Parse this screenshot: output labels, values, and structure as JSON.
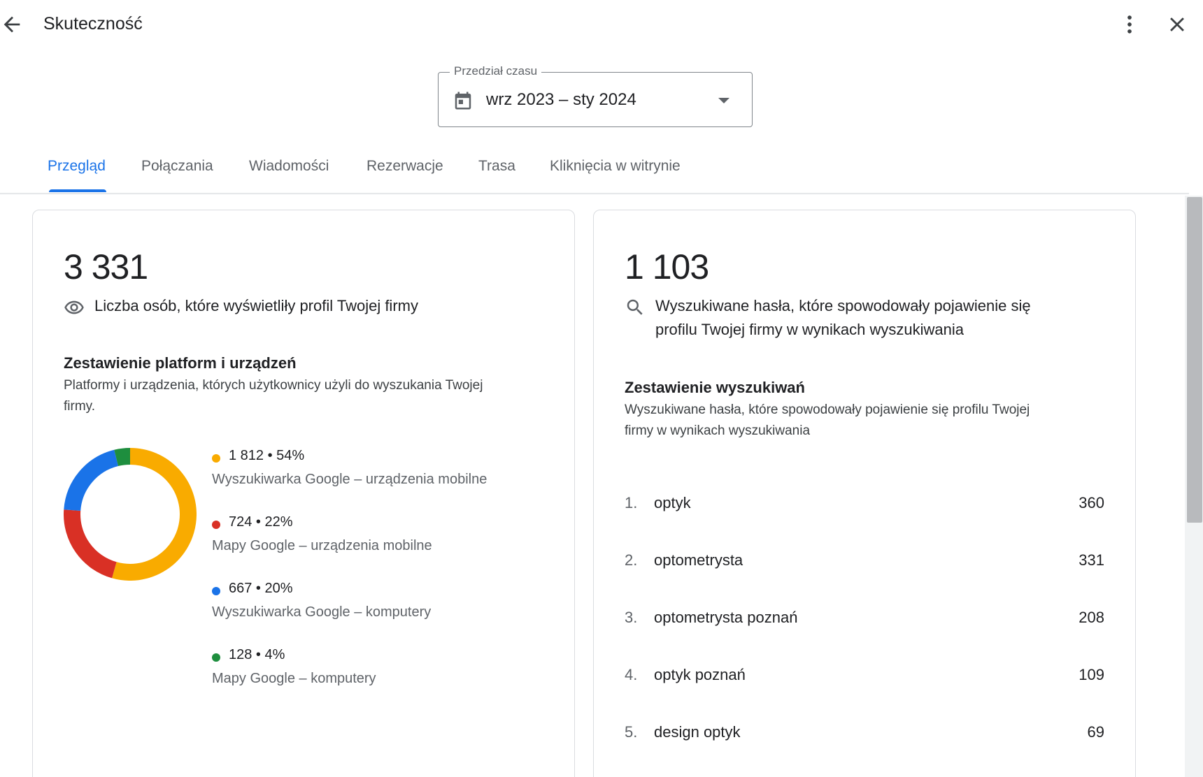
{
  "header": {
    "title": "Skuteczność",
    "icons": {
      "back": "arrow-back-icon",
      "more": "more-vert-icon",
      "close": "close-icon"
    }
  },
  "range": {
    "label": "Przedział czasu",
    "value": "wrz 2023 – sty 2024",
    "icon": "calendar-icon"
  },
  "tabs": [
    {
      "label": "Przegląd",
      "active": true
    },
    {
      "label": "Połączania",
      "active": false
    },
    {
      "label": "Wiadomości",
      "active": false
    },
    {
      "label": "Rezerwacje",
      "active": false
    },
    {
      "label": "Trasa",
      "active": false
    },
    {
      "label": "Kliknięcia w witrynie",
      "active": false
    }
  ],
  "views_card": {
    "total": "3 331",
    "metric_label": "Liczba osób, które wyświetliły profil Twojej firmy",
    "metric_icon": "eye-icon",
    "section_title": "Zestawienie platform i urządzeń",
    "section_desc_line1": "Platformy i urządzenia, których użytkownicy użyli do wyszukania Twojej",
    "section_desc_line2": "firmy."
  },
  "chart_data": {
    "type": "pie",
    "donut": true,
    "categories": [
      "Wyszukiwarka Google – urządzenia mobilne",
      "Mapy Google – urządzenia mobilne",
      "Wyszukiwarka Google – komputery",
      "Mapy Google – komputery"
    ],
    "values": [
      1812,
      724,
      667,
      128
    ],
    "percents": [
      54,
      22,
      20,
      4
    ],
    "value_labels": [
      "1 812 • 54%",
      "724 • 22%",
      "667 • 20%",
      "128 • 4%"
    ],
    "colors": [
      "#f9ab00",
      "#d93025",
      "#1a73e8",
      "#1e8e3e"
    ],
    "legend_position": "right"
  },
  "search_card": {
    "total": "1 103",
    "metric_label_line1": "Wyszukiwane hasła, które spowodowały pojawienie się",
    "metric_label_line2": "profilu Twojej firmy w wynikach wyszukiwania",
    "metric_icon": "search-icon",
    "section_title": "Zestawienie wyszukiwań",
    "section_desc_line1": "Wyszukiwane hasła, które spowodowały pojawienie się profilu Twojej",
    "section_desc_line2": "firmy w wynikach wyszukiwania",
    "terms": [
      {
        "rank": "1.",
        "term": "optyk",
        "count": "360"
      },
      {
        "rank": "2.",
        "term": "optometrysta",
        "count": "331"
      },
      {
        "rank": "3.",
        "term": "optometrysta poznań",
        "count": "208"
      },
      {
        "rank": "4.",
        "term": "optyk poznań",
        "count": "109"
      },
      {
        "rank": "5.",
        "term": "design optyk",
        "count": "69"
      }
    ]
  }
}
